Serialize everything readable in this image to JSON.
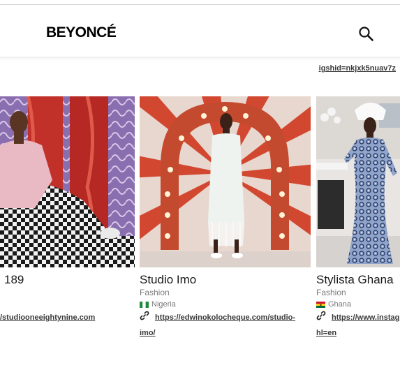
{
  "header": {
    "brand": "BEYONCÉ",
    "search_icon": "search-icon"
  },
  "top_url_fragment": "igshid=nkjxk5nuav7z",
  "cards": [
    {
      "name": "189",
      "url": "/studiooneeightynine.com"
    },
    {
      "name": "Studio Imo",
      "category": "Fashion",
      "country": "Nigeria",
      "flag_colors": [
        "#1f8a3b",
        "#ffffff",
        "#1f8a3b"
      ],
      "url": "https://edwinokolocheque.com/studio-",
      "url_cont": "imo/",
      "link_icon": "link-icon"
    },
    {
      "name": "Stylista Ghana",
      "category": "Fashion",
      "country": "Ghana",
      "flag_colors": [
        "#ce1126",
        "#fcd116",
        "#006b3f"
      ],
      "url": "https://www.instag",
      "url_cont": "hl=en",
      "link_icon": "link-icon"
    }
  ]
}
